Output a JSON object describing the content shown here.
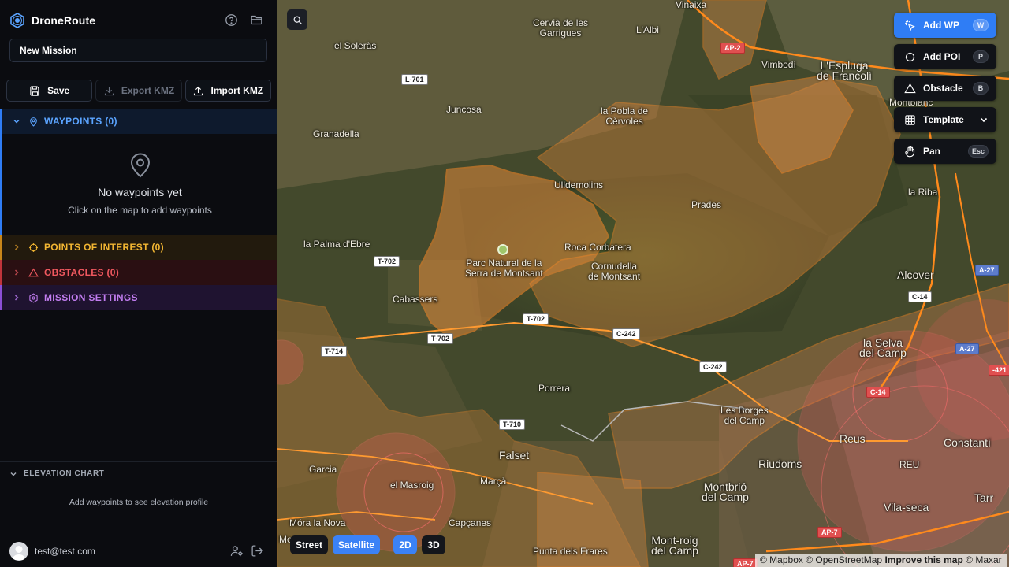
{
  "app": {
    "name": "DroneRoute"
  },
  "mission": {
    "name": "New Mission"
  },
  "toolbar": {
    "save": "Save",
    "export": "Export KMZ",
    "import": "Import KMZ"
  },
  "sections": {
    "waypoints": "WAYPOINTS (0)",
    "poi": "POINTS OF INTEREST (0)",
    "obstacles": "OBSTACLES (0)",
    "settings": "MISSION SETTINGS"
  },
  "waypoints_empty": {
    "title": "No waypoints yet",
    "subtitle": "Click on the map to add waypoints"
  },
  "elevation": {
    "title": "ELEVATION CHART",
    "empty": "Add waypoints to see elevation profile"
  },
  "user": {
    "email": "test@test.com"
  },
  "tools": [
    {
      "label": "Add WP",
      "key": "W",
      "active": true
    },
    {
      "label": "Add POI",
      "key": "P"
    },
    {
      "label": "Obstacle",
      "key": "B"
    },
    {
      "label": "Template"
    },
    {
      "label": "Pan",
      "key": "Esc"
    }
  ],
  "map_layers": {
    "street": "Street",
    "satellite": "Satellite",
    "d2": "2D",
    "d3": "3D"
  },
  "attribution": {
    "mapbox": "© Mapbox",
    "osm": "© OpenStreetMap",
    "improve": "Improve this map",
    "maxar": "© Maxar"
  },
  "places": {
    "vinaixa": "Vinaixa",
    "cervia": "Cervià de les\nGarrigues",
    "albi": "L'Albi",
    "soleras": "el Soleràs",
    "vimbodi": "Vimbodí",
    "espluga": "L'Espluga\nde Francolí",
    "juncosa": "Juncosa",
    "pobla": "la Pobla de\nCèrvoles",
    "montblanc": "Montblanc",
    "granadella": "Granadella",
    "ulldemolins": "Ulldemolins",
    "prades": "Prades",
    "riba": "la Riba",
    "palma": "la Palma d'Ebre",
    "parc": "Parc Natural de la\nSerra de Montsant",
    "roca": "Roca Corbatera",
    "cornudella": "Cornudella\nde Montsant",
    "alcover": "Alcover",
    "cabassers": "Cabassers",
    "selva": "la Selva\ndel Camp",
    "porrera": "Porrera",
    "borges": "Les Borges\ndel Camp",
    "reus": "Reus",
    "constanti": "Constantí",
    "riudoms": "Riudoms",
    "falset": "Falset",
    "garcia": "Garcia",
    "masroig": "el Masroig",
    "marca": "Marçà",
    "montbrio": "Montbrió\ndel Camp",
    "tarr": "Tarr",
    "vilaseca": "Vila-seca",
    "moranova": "Móra la Nova",
    "capcanes": "Capçanes",
    "frares": "Punta dels Frares",
    "montroig": "Mont-roig\ndel Camp",
    "mo": "Mo",
    "reus_airport": "REU"
  },
  "roads": {
    "l701": "L-701",
    "t702a": "T-702",
    "t702b": "T-702",
    "t702c": "T-702",
    "t714": "T-714",
    "c242a": "C-242",
    "c242b": "C-242",
    "t710": "T-710",
    "a27a": "A-27",
    "a27b": "A-27",
    "c14": "C-14",
    "ap2": "AP-2",
    "n421": "-421",
    "ap7a": "AP-7",
    "ap7b": "AP-7",
    "c14b": "C-14"
  },
  "colors": {
    "accent": "#2f7df5",
    "poi": "#f2b632",
    "obstacle": "#f0585f",
    "settings": "#c27df0",
    "restricted_zone": "#e8853a"
  }
}
